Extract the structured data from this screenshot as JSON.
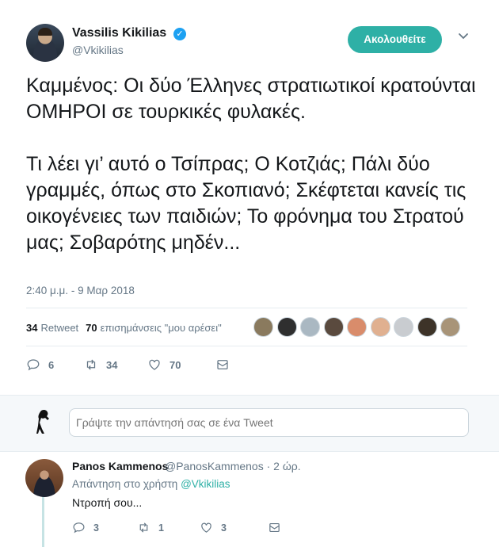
{
  "tweet": {
    "author_name": "Vassilis Kikilias",
    "author_handle": "@Vkikilias",
    "verified_glyph": "✓",
    "follow_label": "Ακολουθείτε",
    "caret_icon": "chevron-down-icon",
    "text": "Καμμένος: Οι δύο Έλληνες στρατιωτικοί κρατούνται ΟΜΗΡΟΙ σε τουρκικές φυλακές.\n\nΤι λέει γι’ αυτό ο Τσίπρας; Ο Κοτζιάς; Πάλι δύο γραμμές, όπως στο Σκοπιανό; Σκέφτεται κανείς τις οικογένειες των παιδιών; Το φρόνημα του Στρατού μας; Σοβαρότης μηδέν...",
    "timestamp": "2:40 μ.μ. - 9 Μαρ 2018",
    "retweet_count": "34",
    "retweet_label": "Retweet",
    "like_count": "70",
    "like_label": "επισημάνσεις \"μου αρέσει\"",
    "likers": [
      "#8a7a5e",
      "#2f2f2f",
      "#aab8c2",
      "#5a4a3e",
      "#d98c6b",
      "#e0b090",
      "#c9ccd0",
      "#3d3328",
      "#a89478"
    ],
    "actions": {
      "replies": "6",
      "retweets": "34",
      "likes": "70"
    }
  },
  "reply_box": {
    "placeholder": "Γράψτε την απάντησή σας σε ένα Tweet"
  },
  "reply": {
    "author_name": "Panos Kammenos",
    "author_handle": "@PanosKammenos · 2 ώρ.",
    "reply_to_prefix": "Απάντηση στο χρήστη",
    "reply_to_handle": "@Vkikilias",
    "text": "Ντροπή σου...",
    "actions": {
      "replies": "3",
      "retweets": "1",
      "likes": "3"
    }
  },
  "colors": {
    "accent": "#2eb0a6",
    "verified": "#1da1f2",
    "muted": "#657786",
    "thread": "#c6e3e4"
  }
}
